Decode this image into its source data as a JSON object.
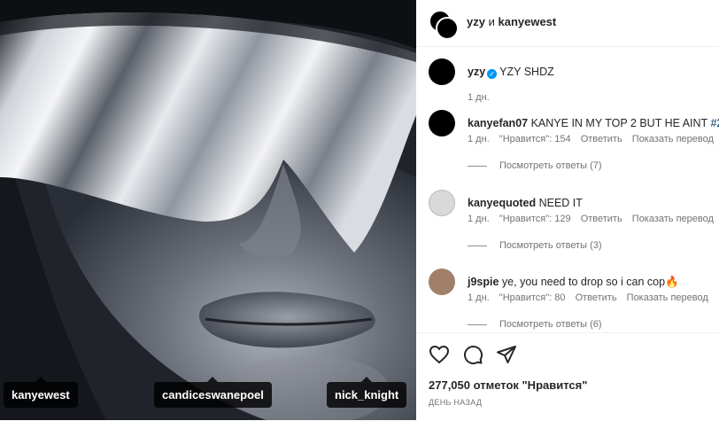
{
  "photo": {
    "tags": [
      "kanyewest",
      "candiceswanepoel",
      "nick_knight"
    ]
  },
  "header": {
    "user1": "yzy",
    "joiner": "и",
    "user2": "kanyewest"
  },
  "caption": {
    "username": "yzy",
    "text": "YZY SHDZ",
    "time": "1 дн."
  },
  "comments": [
    {
      "username": "kanyefan07",
      "text": "KANYE IN MY TOP 2 BUT HE AINT",
      "hashtag": "#2",
      "time": "1 дн.",
      "likes": "\"Нравится\": 154",
      "reply": "Ответить",
      "translate": "Показать перевод",
      "view_replies": "Посмотреть ответы (7)"
    },
    {
      "username": "kanyequoted",
      "text": "NEED IT",
      "time": "1 дн.",
      "likes": "\"Нравится\": 129",
      "reply": "Ответить",
      "translate": "Показать перевод",
      "view_replies": "Посмотреть ответы (3)"
    },
    {
      "username": "j9spie",
      "text": "ye, you need to drop so i can cop🔥",
      "time": "1 дн.",
      "likes": "\"Нравится\": 80",
      "reply": "Ответить",
      "translate": "Показать перевод",
      "view_replies": "Посмотреть ответы (6)"
    }
  ],
  "actions": {
    "icons": [
      "heart-icon",
      "comment-icon",
      "share-icon"
    ],
    "likes_count": "277,050 отметок \"Нравится\"",
    "date": "ДЕНЬ НАЗАД"
  },
  "colors": {
    "accent": "#0095f6",
    "hashtag": "#00376b",
    "secondary": "#737373"
  }
}
